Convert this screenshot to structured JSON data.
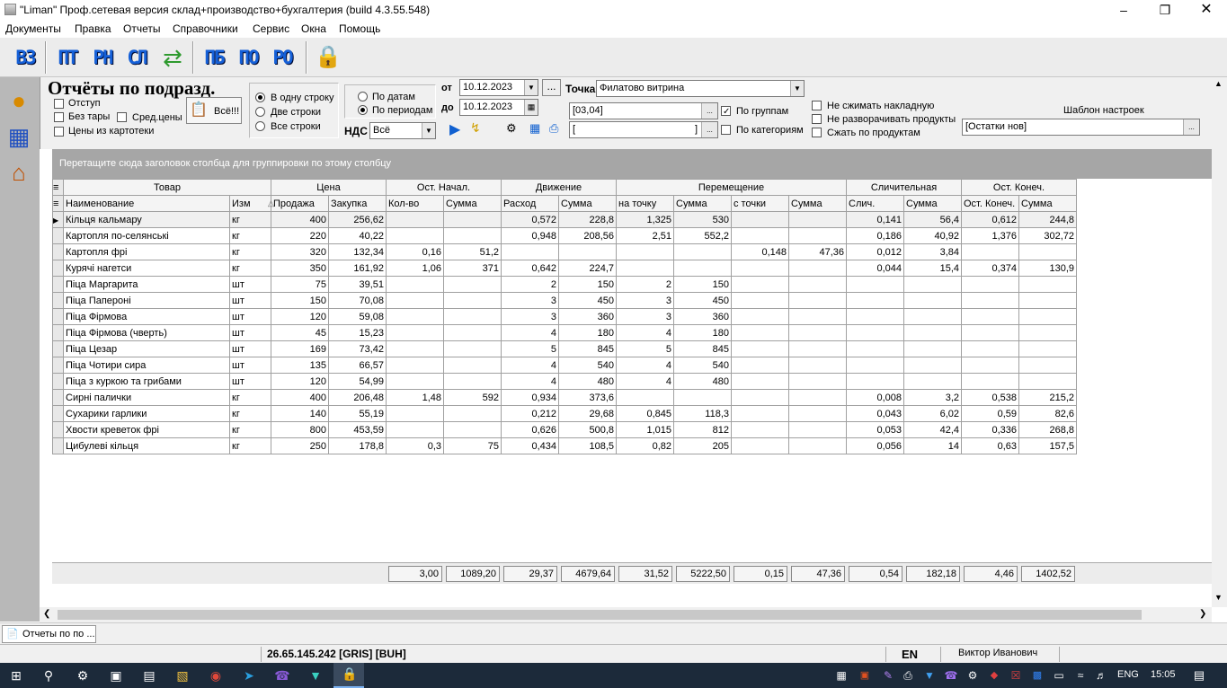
{
  "window": {
    "title": "\"Liman\" Проф.сетевая версия склад+производство+бухгалтерия (build 4.3.55.548)"
  },
  "menu": [
    "Документы",
    "Правка",
    "Отчеты",
    "Справочники",
    "Сервис",
    "Окна",
    "Помощь"
  ],
  "toolbar": {
    "buttons": [
      "ВЗ",
      "ПТ",
      "РН",
      "СЛ",
      "ПБ",
      "ПО",
      "РО"
    ]
  },
  "panel": {
    "title": "Отчёты по подразд.",
    "cb_otstup": "Отступ",
    "cb_beztary": "Без тары",
    "cb_sredceny": "Сред.цены",
    "cb_ceny": "Цены из картотеки",
    "all_button": "Всё!!!",
    "rows_opt": [
      "В одну строку",
      "Две строки",
      "Все строки"
    ],
    "period_opt": [
      "По датам",
      "По периодам"
    ],
    "nds_label": "НДС",
    "nds_value": "Всё",
    "from_label": "от",
    "from_date": "10.12.2023",
    "to_label": "до",
    "to_date": "10.12.2023",
    "dots": "...",
    "point_label": "Точка",
    "point_value": "Филатово витрина",
    "group_value": "[03,04]",
    "cat_value": "[",
    "cat_suffix": "]",
    "cb_pogruppam": "По группам",
    "cb_pokateg": "По категориям",
    "cb_nesjimat": "Не сжимать накладную",
    "cb_nerazv": "Не разворачивать продукты",
    "cb_sjat": "Сжать по продуктам",
    "template_label": "Шаблон настроек",
    "template_value": "[Остатки нов]"
  },
  "group_hint": "Перетащите сюда заголовок столбца для группировки по этому столбцу",
  "grid": {
    "bands": [
      "Товар",
      "Цена",
      "Ост. Начал.",
      "Движение",
      "Перемещение",
      "Сличительная",
      "Ост. Конеч."
    ],
    "columns": [
      "Наименование",
      "Изм",
      "Продажа",
      "Закупка",
      "Кол-во",
      "Сумма",
      "Расход",
      "Сумма",
      "на точку",
      "Сумма",
      "с точки",
      "Сумма",
      "Слич.",
      "Сумма",
      "Ост. Конеч.",
      "Сумма"
    ],
    "rows": [
      [
        "Кільця кальмару",
        "кг",
        "400",
        "256,62",
        "",
        "",
        "0,572",
        "228,8",
        "1,325",
        "530",
        "",
        "",
        "0,141",
        "56,4",
        "0,612",
        "244,8"
      ],
      [
        "Картопля по-селянські",
        "кг",
        "220",
        "40,22",
        "",
        "",
        "0,948",
        "208,56",
        "2,51",
        "552,2",
        "",
        "",
        "0,186",
        "40,92",
        "1,376",
        "302,72"
      ],
      [
        "Картопля фрі",
        "кг",
        "320",
        "132,34",
        "0,16",
        "51,2",
        "",
        "",
        "",
        "",
        "0,148",
        "47,36",
        "0,012",
        "3,84",
        "",
        ""
      ],
      [
        "Курячі нагетси",
        "кг",
        "350",
        "161,92",
        "1,06",
        "371",
        "0,642",
        "224,7",
        "",
        "",
        "",
        "",
        "0,044",
        "15,4",
        "0,374",
        "130,9"
      ],
      [
        "Піца Маргарита",
        "шт",
        "75",
        "39,51",
        "",
        "",
        "2",
        "150",
        "2",
        "150",
        "",
        "",
        "",
        "",
        "",
        ""
      ],
      [
        "Піца Папероні",
        "шт",
        "150",
        "70,08",
        "",
        "",
        "3",
        "450",
        "3",
        "450",
        "",
        "",
        "",
        "",
        "",
        ""
      ],
      [
        "Піца Фірмова",
        "шт",
        "120",
        "59,08",
        "",
        "",
        "3",
        "360",
        "3",
        "360",
        "",
        "",
        "",
        "",
        "",
        ""
      ],
      [
        "Піца Фірмова (чверть)",
        "шт",
        "45",
        "15,23",
        "",
        "",
        "4",
        "180",
        "4",
        "180",
        "",
        "",
        "",
        "",
        "",
        ""
      ],
      [
        "Піца Цезар",
        "шт",
        "169",
        "73,42",
        "",
        "",
        "5",
        "845",
        "5",
        "845",
        "",
        "",
        "",
        "",
        "",
        ""
      ],
      [
        "Піца Чотири сира",
        "шт",
        "135",
        "66,57",
        "",
        "",
        "4",
        "540",
        "4",
        "540",
        "",
        "",
        "",
        "",
        "",
        ""
      ],
      [
        "Піца з куркою та грибами",
        "шт",
        "120",
        "54,99",
        "",
        "",
        "4",
        "480",
        "4",
        "480",
        "",
        "",
        "",
        "",
        "",
        ""
      ],
      [
        "Сирні палички",
        "кг",
        "400",
        "206,48",
        "1,48",
        "592",
        "0,934",
        "373,6",
        "",
        "",
        "",
        "",
        "0,008",
        "3,2",
        "0,538",
        "215,2"
      ],
      [
        "Сухарики гарлики",
        "кг",
        "140",
        "55,19",
        "",
        "",
        "0,212",
        "29,68",
        "0,845",
        "118,3",
        "",
        "",
        "0,043",
        "6,02",
        "0,59",
        "82,6"
      ],
      [
        "Хвости креветок фрі",
        "кг",
        "800",
        "453,59",
        "",
        "",
        "0,626",
        "500,8",
        "1,015",
        "812",
        "",
        "",
        "0,053",
        "42,4",
        "0,336",
        "268,8"
      ],
      [
        "Цибулеві кільця",
        "кг",
        "250",
        "178,8",
        "0,3",
        "75",
        "0,434",
        "108,5",
        "0,82",
        "205",
        "",
        "",
        "0,056",
        "14",
        "0,63",
        "157,5"
      ]
    ],
    "totals": [
      "3,00",
      "1089,20",
      "29,37",
      "4679,64",
      "31,52",
      "5222,50",
      "0,15",
      "47,36",
      "0,54",
      "182,18",
      "4,46",
      "1402,52"
    ]
  },
  "tab": {
    "label": "Отчеты по по ..."
  },
  "status": {
    "server": "26.65.145.242 [GRIS] [BUH]",
    "lang": "EN",
    "user": "Виктор Иванович"
  },
  "taskbar": {
    "lang": "ENG",
    "time": "15:05"
  }
}
